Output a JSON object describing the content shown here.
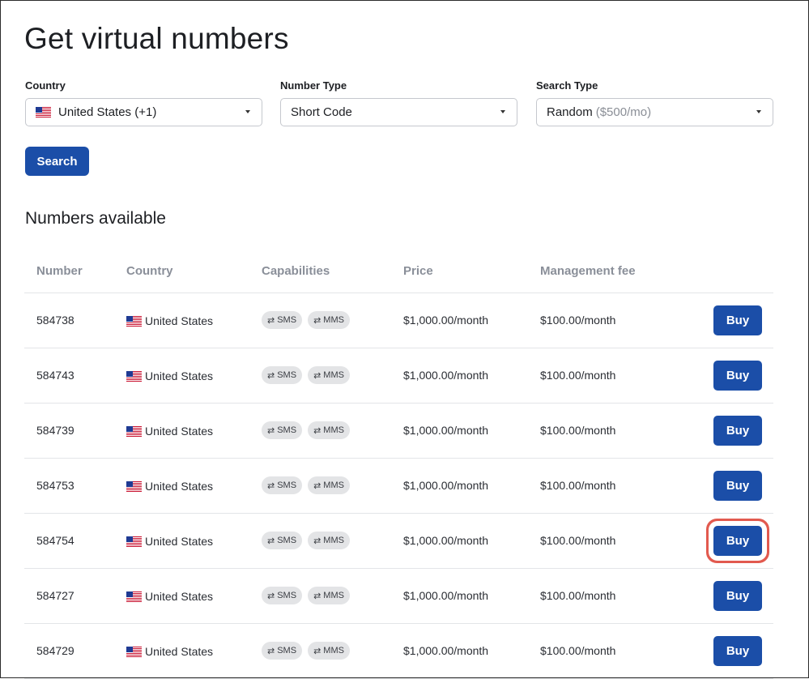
{
  "page": {
    "title": "Get virtual numbers"
  },
  "filters": {
    "country": {
      "label": "Country",
      "value": "United States (+1)",
      "flag": "us-flag-icon"
    },
    "number_type": {
      "label": "Number Type",
      "value": "Short Code"
    },
    "search_type": {
      "label": "Search Type",
      "value": "Random",
      "price_hint": "($500/mo)"
    }
  },
  "search_button": {
    "label": "Search"
  },
  "results": {
    "heading": "Numbers available",
    "columns": [
      "Number",
      "Country",
      "Capabilities",
      "Price",
      "Management fee"
    ],
    "rows": [
      {
        "number": "584738",
        "country": "United States",
        "caps": [
          "SMS",
          "MMS"
        ],
        "price": "$1,000.00/month",
        "fee": "$100.00/month",
        "action": "Buy"
      },
      {
        "number": "584743",
        "country": "United States",
        "caps": [
          "SMS",
          "MMS"
        ],
        "price": "$1,000.00/month",
        "fee": "$100.00/month",
        "action": "Buy"
      },
      {
        "number": "584739",
        "country": "United States",
        "caps": [
          "SMS",
          "MMS"
        ],
        "price": "$1,000.00/month",
        "fee": "$100.00/month",
        "action": "Buy"
      },
      {
        "number": "584753",
        "country": "United States",
        "caps": [
          "SMS",
          "MMS"
        ],
        "price": "$1,000.00/month",
        "fee": "$100.00/month",
        "action": "Buy"
      },
      {
        "number": "584754",
        "country": "United States",
        "caps": [
          "SMS",
          "MMS"
        ],
        "price": "$1,000.00/month",
        "fee": "$100.00/month",
        "action": "Buy",
        "highlighted": true
      },
      {
        "number": "584727",
        "country": "United States",
        "caps": [
          "SMS",
          "MMS"
        ],
        "price": "$1,000.00/month",
        "fee": "$100.00/month",
        "action": "Buy"
      },
      {
        "number": "584729",
        "country": "United States",
        "caps": [
          "SMS",
          "MMS"
        ],
        "price": "$1,000.00/month",
        "fee": "$100.00/month",
        "action": "Buy"
      }
    ]
  },
  "colors": {
    "primary": "#1b4ea8",
    "highlight": "#e25a4f",
    "pill_bg": "#e3e4e6"
  },
  "icons": {
    "capability": "swap-arrows-icon",
    "dropdown": "caret-down-icon",
    "flag": "us-flag-icon"
  }
}
